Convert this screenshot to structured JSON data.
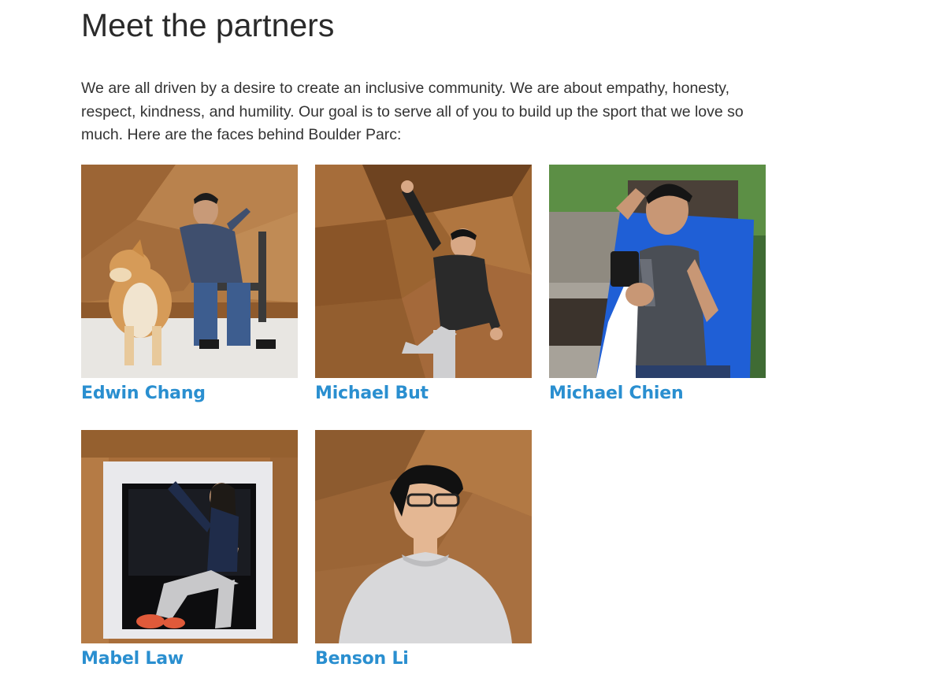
{
  "page": {
    "title": "Meet the partners",
    "intro": "We are all driven by a desire to create an inclusive community. We are about empathy, honesty, respect, kindness, and humility. Our goal is to serve all of you to build up the sport that we love so much. Here are the faces behind Boulder Parc:"
  },
  "partners": [
    {
      "name": "Edwin Chang"
    },
    {
      "name": "Michael But"
    },
    {
      "name": "Michael Chien"
    },
    {
      "name": "Mabel Law"
    },
    {
      "name": "Benson Li"
    }
  ],
  "colors": {
    "link": "#2a8fd0",
    "text": "#333333",
    "wood": "#a86a38"
  }
}
